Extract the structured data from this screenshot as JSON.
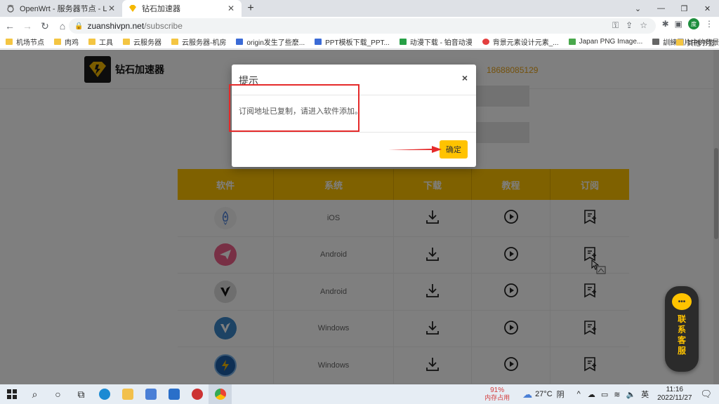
{
  "browser": {
    "tabs": [
      {
        "title": "OpenWrt - 服务器节点 - LuCI",
        "active": false
      },
      {
        "title": "钻石加速器",
        "active": true
      }
    ],
    "url_host": "zuanshivpn.net",
    "url_path": "/subscribe",
    "profile_initial": "度",
    "bookmarks": [
      {
        "label": "机场节点",
        "icon": "folder"
      },
      {
        "label": "肉鸡",
        "icon": "folder"
      },
      {
        "label": "工具",
        "icon": "folder"
      },
      {
        "label": "云服务器",
        "icon": "folder"
      },
      {
        "label": "云服务器-机房",
        "icon": "folder"
      },
      {
        "label": "origin发生了些麽...",
        "icon": "paw"
      },
      {
        "label": "PPT模板下载_PPT...",
        "icon": "ppt"
      },
      {
        "label": "动漫下载 - 铂音动漫",
        "icon": "anime"
      },
      {
        "label": "背景元素设计元素_...",
        "icon": "p-red"
      },
      {
        "label": "Japan PNG Image...",
        "icon": "png"
      },
      {
        "label": "訓練圖片中的背景...",
        "icon": "cap"
      }
    ],
    "bookmarks_more": "»",
    "other_bookmarks": "其他书签"
  },
  "site": {
    "brand": "钻石加速器",
    "phone": "18688085129",
    "table": {
      "headers": [
        "软件",
        "系统",
        "下载",
        "教程",
        "订阅"
      ],
      "rows": [
        {
          "system": "iOS",
          "app_color": "#f0f0f0",
          "glyph": "rocket"
        },
        {
          "system": "Android",
          "app_color": "#f0608a",
          "glyph": "plane"
        },
        {
          "system": "Android",
          "app_color": "#ddd",
          "glyph": "v-black"
        },
        {
          "system": "Windows",
          "app_color": "#3a86c8",
          "glyph": "v-white"
        },
        {
          "system": "Windows",
          "app_color": "#1c5fa8",
          "glyph": "bolt"
        }
      ]
    },
    "chat_widget": {
      "label": "联系客服"
    }
  },
  "modal": {
    "title": "提示",
    "message": "订阅地址已复制，请进入软件添加。",
    "ok_label": "确定",
    "close_glyph": "×"
  },
  "taskbar": {
    "memory_percent": "91%",
    "memory_label": "内存占用",
    "temperature": "27°C",
    "weather": "阴",
    "ime": "英",
    "time": "11:16",
    "date": "2022/11/27"
  }
}
